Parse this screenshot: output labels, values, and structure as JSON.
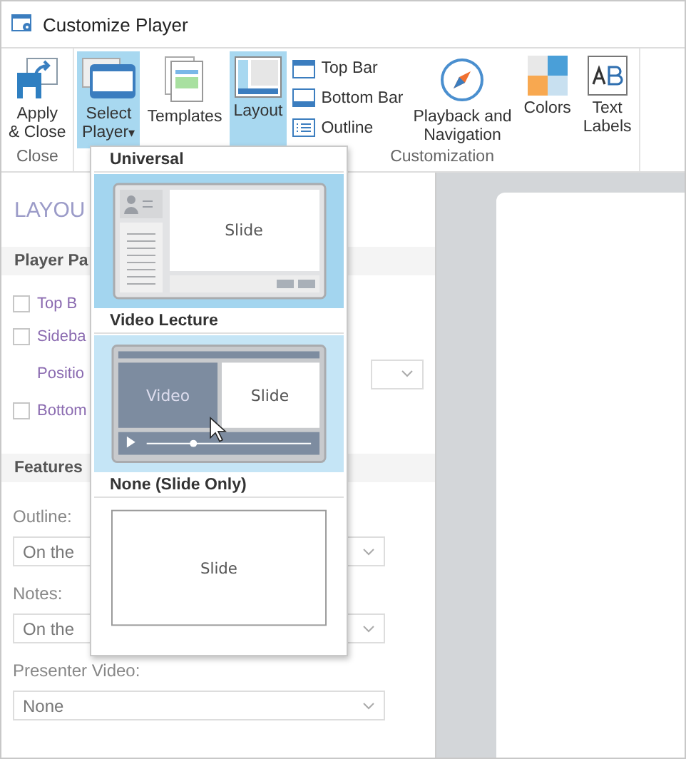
{
  "window": {
    "title": "Customize Player"
  },
  "ribbon": {
    "groups": [
      {
        "label": "Close",
        "buttons": [
          {
            "kind": "large",
            "label": "Apply\n& Close",
            "selected": false
          }
        ]
      },
      {
        "label": "Customization",
        "buttons": [
          {
            "kind": "large",
            "label": "Select\nPlayer",
            "caret": "▾",
            "selected": true
          },
          {
            "kind": "large",
            "label": "Templates",
            "selected": false
          },
          {
            "kind": "large",
            "label": "Layout",
            "selected": true
          },
          {
            "kind": "stack",
            "items": [
              {
                "label": "Top Bar"
              },
              {
                "label": "Bottom Bar"
              },
              {
                "label": "Outline"
              }
            ]
          },
          {
            "kind": "large",
            "label": "Playback and\nNavigation",
            "selected": false
          },
          {
            "kind": "large",
            "label": "Colors",
            "selected": false
          },
          {
            "kind": "large",
            "label": "Text\nLabels",
            "selected": false
          }
        ]
      }
    ]
  },
  "panel": {
    "heading": "LAYOU",
    "sections": [
      {
        "title": "Player Pa",
        "items": [
          {
            "kind": "checkbox",
            "label": "Top B",
            "checked": false
          },
          {
            "kind": "checkbox",
            "label": "Sideba",
            "checked": false
          },
          {
            "kind": "select",
            "label": "Positio"
          },
          {
            "kind": "checkbox",
            "label": "Bottom",
            "checked": false
          }
        ]
      },
      {
        "title": "Features",
        "items": [
          {
            "kind": "field",
            "label": "Outline:",
            "value": "On the "
          },
          {
            "kind": "field",
            "label": "Notes:",
            "value": "On the "
          },
          {
            "kind": "field",
            "label": "Presenter Video:",
            "value": "None"
          }
        ]
      }
    ]
  },
  "player_menu": [
    {
      "title": "Universal",
      "kind": "universal",
      "selected": true,
      "hovered": false,
      "slide": "Slide"
    },
    {
      "title": "Video Lecture",
      "kind": "video",
      "selected": false,
      "hovered": true,
      "slide": "Slide",
      "video": "Video"
    },
    {
      "title": "None (Slide Only)",
      "kind": "slide",
      "selected": false,
      "hovered": false,
      "slide": "Slide"
    }
  ]
}
